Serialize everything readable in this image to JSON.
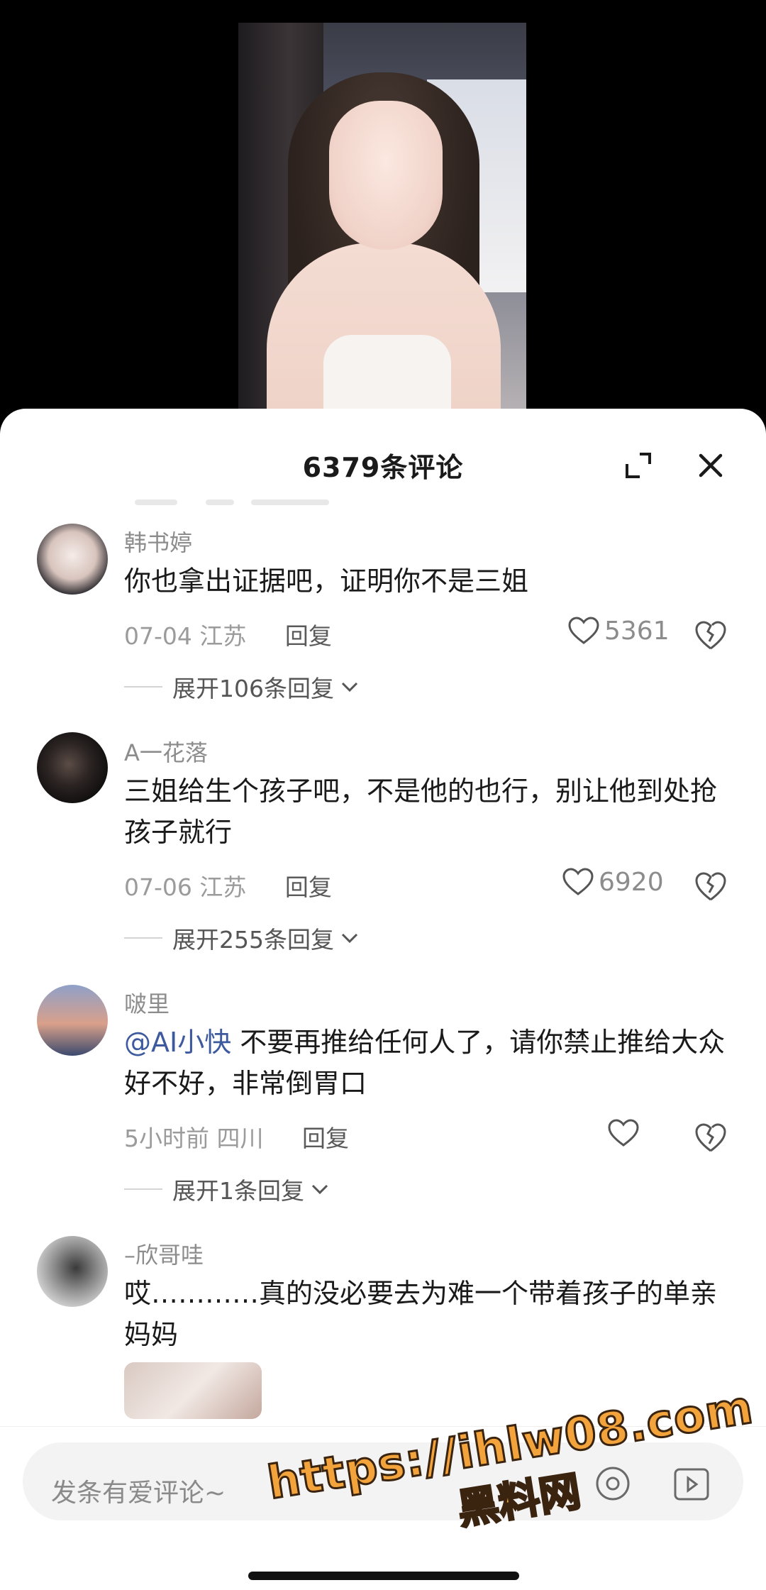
{
  "sheet": {
    "title": "6379条评论"
  },
  "comments": [
    {
      "username": "韩书婷",
      "text": "你也拿出证据吧，证明你不是三姐",
      "date": "07-04",
      "location": "江苏",
      "reply_label": "回复",
      "likes": "5361",
      "expand_label": "展开106条回复"
    },
    {
      "username": "A一花落",
      "text": "三姐给生个孩子吧，不是他的也行，别让他到处抢孩子就行",
      "date": "07-06",
      "location": "江苏",
      "reply_label": "回复",
      "likes": "6920",
      "expand_label": "展开255条回复"
    },
    {
      "username": "啵里",
      "mention": "@AI小快",
      "text": " 不要再推给任何人了，请你禁止推给大众好不好，非常倒胃口",
      "date": "5小时前",
      "location": "四川",
      "reply_label": "回复",
      "likes": "",
      "expand_label": "展开1条回复"
    },
    {
      "username": "–欣哥哇",
      "text": "哎…………真的没必要去为难一个带着孩子的单亲妈妈"
    }
  ],
  "input": {
    "placeholder": "发条有爱评论~"
  },
  "watermark": {
    "url": "https://ihlw08.com",
    "site_name": "黑料网"
  },
  "colors": {
    "mention": "#3d5a9e",
    "watermark": "#f3a33c"
  }
}
